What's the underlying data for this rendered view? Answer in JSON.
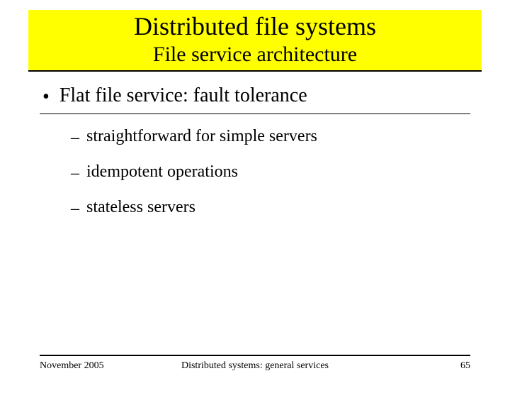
{
  "header": {
    "title": "Distributed file systems",
    "subtitle": "File service architecture"
  },
  "body": {
    "bullet1": "Flat file service: fault tolerance",
    "sub1": "straightforward for simple servers",
    "sub2": "idempotent operations",
    "sub3": "stateless servers"
  },
  "footer": {
    "left": "November 2005",
    "center": "Distributed systems: general services",
    "right": "65"
  }
}
